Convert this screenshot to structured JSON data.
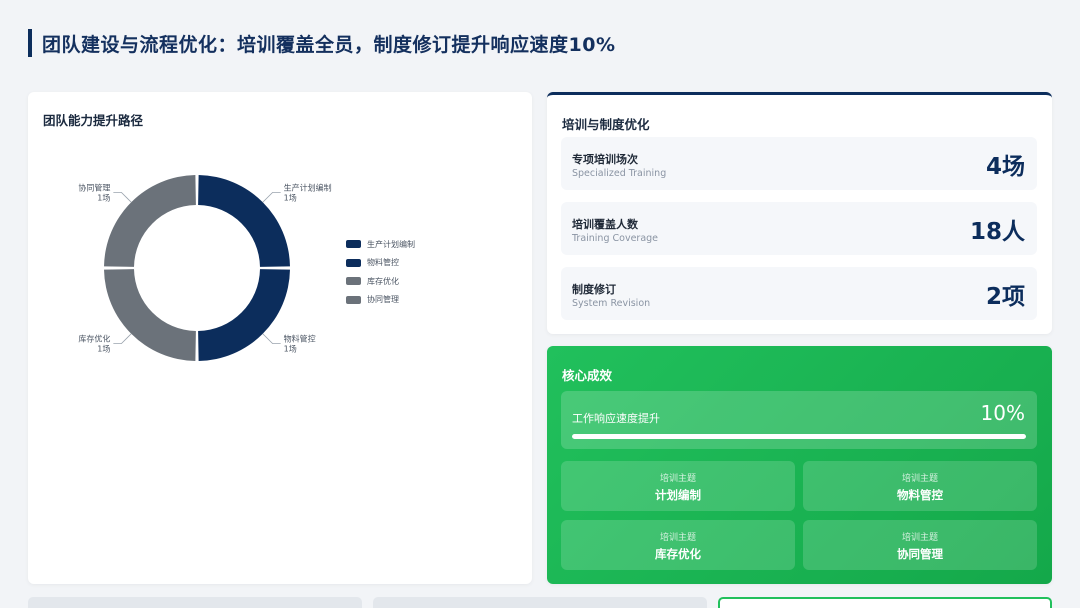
{
  "page": {
    "title": "团队建设与流程优化：培训覆盖全员，制度修订提升响应速度10%"
  },
  "path_card": {
    "title": "团队能力提升路径",
    "legend": [
      "生产计划编制",
      "物料管控",
      "库存优化",
      "协同管理"
    ]
  },
  "chart_data": {
    "type": "pie",
    "donut": true,
    "categories": [
      "生产计划编制",
      "物料管控",
      "库存优化",
      "协同管理"
    ],
    "values": [
      1,
      1,
      1,
      1
    ],
    "value_labels": [
      "1场",
      "1场",
      "1场",
      "1场"
    ],
    "colors": [
      "#0c2d5c",
      "#0c2d5c",
      "#6b727a",
      "#6b727a"
    ],
    "legend_position": "right"
  },
  "training_card": {
    "title": "培训与制度优化",
    "stats": [
      {
        "name": "专项培训场次",
        "sub": "Specialized Training",
        "value": "4场"
      },
      {
        "name": "培训覆盖人数",
        "sub": "Training Coverage",
        "value": "18人"
      },
      {
        "name": "制度修订",
        "sub": "System Revision",
        "value": "2项"
      }
    ]
  },
  "core_card": {
    "title": "核心成效",
    "progress": {
      "label": "工作响应速度提升",
      "value_text": "10%",
      "fill_percent": 100
    },
    "topics": [
      {
        "tag": "培训主题",
        "name": "计划编制"
      },
      {
        "tag": "培训主题",
        "name": "物料管控"
      },
      {
        "tag": "培训主题",
        "name": "库存优化"
      },
      {
        "tag": "培训主题",
        "name": "协同管理"
      }
    ]
  },
  "colors": {
    "navy": "#0c2d5c",
    "gray": "#6b727a",
    "green": "#1db455"
  }
}
